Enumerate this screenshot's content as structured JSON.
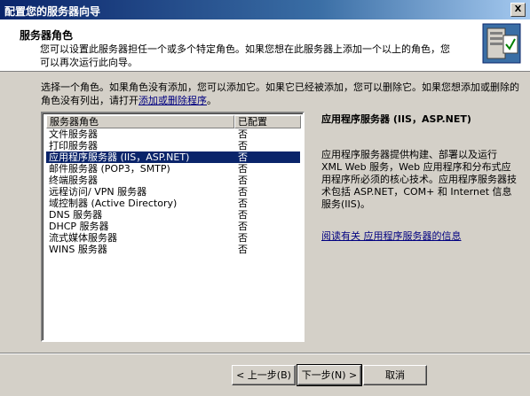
{
  "window": {
    "title": "配置您的服务器向导",
    "close_label": "X"
  },
  "header": {
    "title": "服务器角色",
    "description": "您可以设置此服务器担任一个或多个特定角色。如果您想在此服务器上添加一个以上的角色，您可以再次运行此向导。",
    "icon": "server-wizard-icon"
  },
  "instructions": {
    "text": "选择一个角色。如果角色没有添加，您可以添加它。如果它已经被添加，您可以删除它。如果您想添加或删除的角色没有列出，请打开",
    "link": "添加或删除程序",
    "suffix": "。"
  },
  "role_list": {
    "columns": [
      "服务器角色",
      "已配置"
    ],
    "rows": [
      {
        "name": "文件服务器",
        "configured": "否"
      },
      {
        "name": "打印服务器",
        "configured": "否"
      },
      {
        "name": "应用程序服务器 (IIS，ASP.NET)",
        "configured": "否"
      },
      {
        "name": "邮件服务器 (POP3，SMTP)",
        "configured": "否"
      },
      {
        "name": "终端服务器",
        "configured": "否"
      },
      {
        "name": "远程访问/ VPN 服务器",
        "configured": "否"
      },
      {
        "name": "域控制器 (Active Directory)",
        "configured": "否"
      },
      {
        "name": "DNS 服务器",
        "configured": "否"
      },
      {
        "name": "DHCP 服务器",
        "configured": "否"
      },
      {
        "name": "流式媒体服务器",
        "configured": "否"
      },
      {
        "name": "WINS 服务器",
        "configured": "否"
      }
    ],
    "selected_index": 2
  },
  "detail": {
    "title": "应用程序服务器 (IIS，ASP.NET)",
    "description": "应用程序服务器提供构建、部署以及运行 XML Web 服务，Web 应用程序和分布式应用程序所必须的核心技术。应用程序服务器技术包括 ASP.NET，COM+ 和 Internet 信息服务(IIS)。",
    "link": "阅读有关 应用程序服务器的信息"
  },
  "buttons": {
    "back": "< 上一步(B)",
    "next": "下一步(N) >",
    "cancel": "取消"
  }
}
